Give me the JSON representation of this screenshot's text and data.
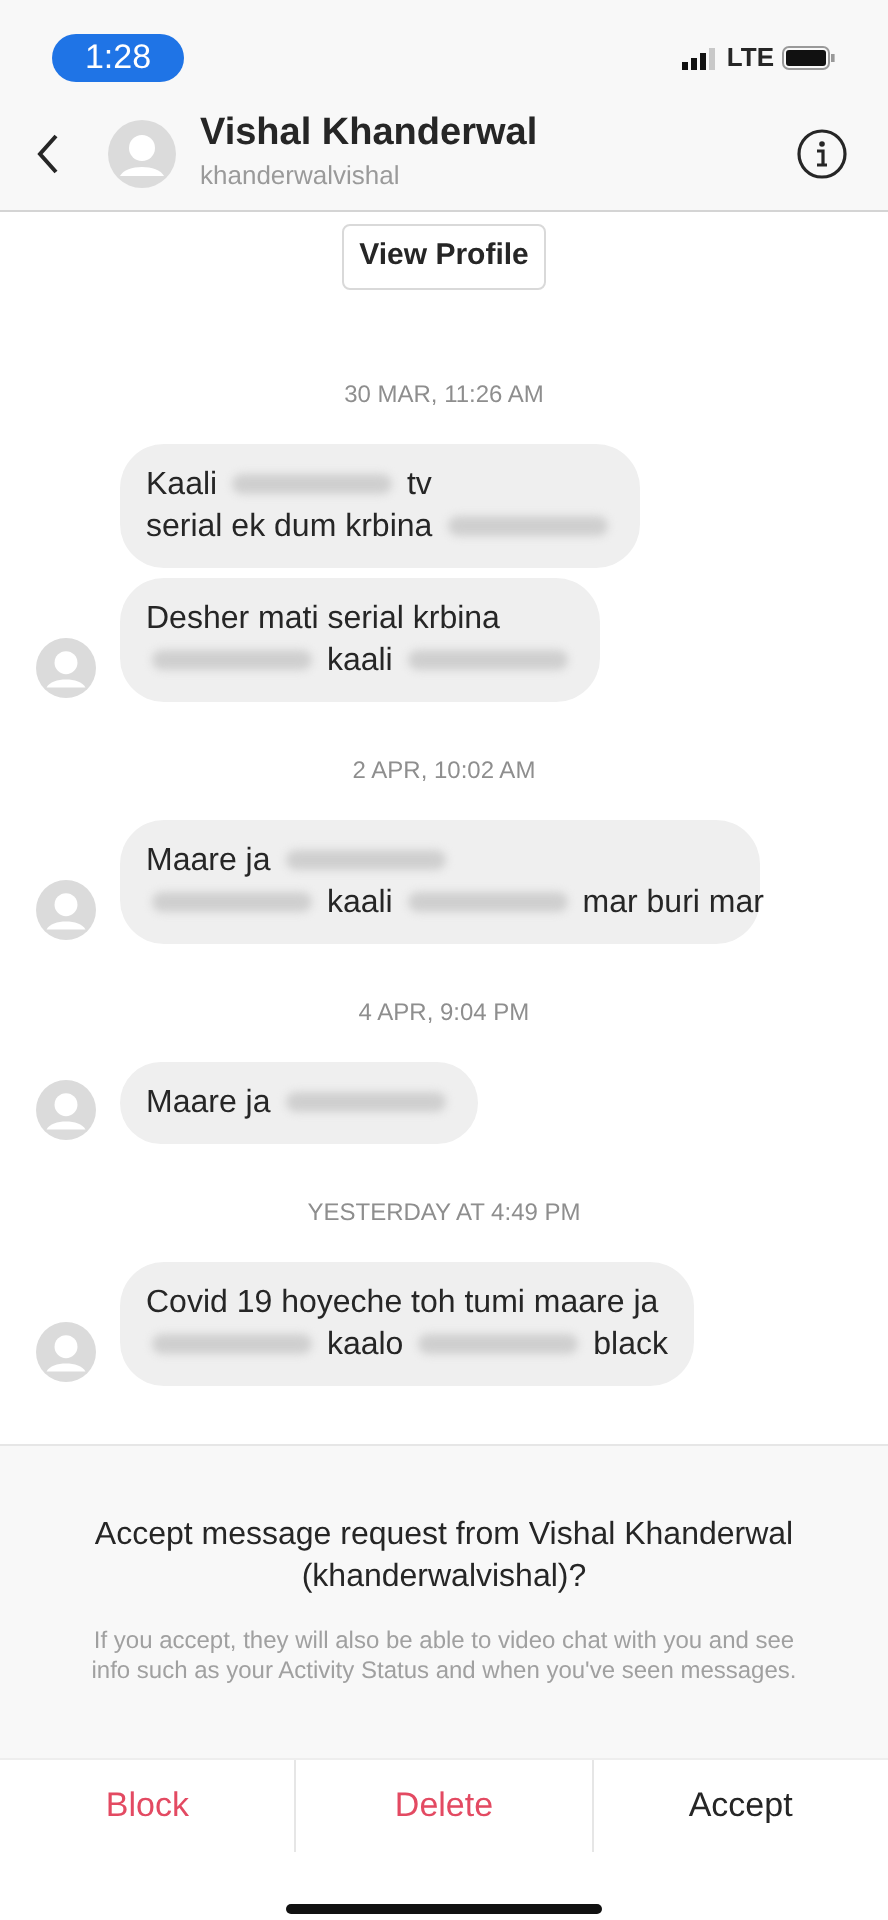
{
  "status_bar": {
    "time": "1:28",
    "network": "LTE"
  },
  "header": {
    "name": "Vishal Khanderwal",
    "username": "khanderwalvishal"
  },
  "view_profile": "View Profile",
  "thread": [
    {
      "kind": "time",
      "text": "30 MAR, 11:26 AM"
    },
    {
      "kind": "message",
      "avatar": false,
      "lines": [
        [
          {
            "kind": "text",
            "text": "Kaali"
          },
          {
            "kind": "blurred"
          },
          {
            "kind": "text",
            "text": "tv"
          }
        ],
        [
          {
            "kind": "text",
            "text": "serial ek dum krbina"
          },
          {
            "kind": "blurred"
          }
        ]
      ]
    },
    {
      "kind": "message",
      "avatar": true,
      "lines": [
        [
          {
            "kind": "text",
            "text": "Desher mati serial krbina"
          }
        ],
        [
          {
            "kind": "blurred"
          },
          {
            "kind": "text",
            "text": "kaali"
          },
          {
            "kind": "blurred"
          }
        ]
      ]
    },
    {
      "kind": "time",
      "text": "2 APR, 10:02 AM"
    },
    {
      "kind": "message",
      "avatar": true,
      "lines": [
        [
          {
            "kind": "text",
            "text": "Maare ja"
          },
          {
            "kind": "blurred"
          }
        ],
        [
          {
            "kind": "blurred"
          },
          {
            "kind": "text",
            "text": "kaali"
          },
          {
            "kind": "blurred"
          },
          {
            "kind": "text",
            "text": "mar buri mar"
          }
        ]
      ]
    },
    {
      "kind": "time",
      "text": "4 APR, 9:04 PM"
    },
    {
      "kind": "message",
      "avatar": true,
      "lines": [
        [
          {
            "kind": "text",
            "text": "Maare ja"
          },
          {
            "kind": "blurred"
          }
        ]
      ]
    },
    {
      "kind": "time",
      "text": "YESTERDAY AT 4:49 PM"
    },
    {
      "kind": "message",
      "avatar": true,
      "lines": [
        [
          {
            "kind": "text",
            "text": "Covid 19 hoyeche toh tumi maare ja"
          }
        ],
        [
          {
            "kind": "blurred"
          },
          {
            "kind": "text",
            "text": "kaalo"
          },
          {
            "kind": "blurred"
          },
          {
            "kind": "text",
            "text": "black"
          }
        ]
      ]
    }
  ],
  "request": {
    "title": "Accept message request from Vishal Khanderwal (khanderwalvishal)?",
    "note": "If you accept, they will also be able to video chat with you and see info such as your Activity Status and when you've seen messages."
  },
  "actions": [
    {
      "label": "Block",
      "kind": "danger"
    },
    {
      "label": "Delete",
      "kind": "danger"
    },
    {
      "label": "Accept",
      "kind": "default"
    }
  ]
}
